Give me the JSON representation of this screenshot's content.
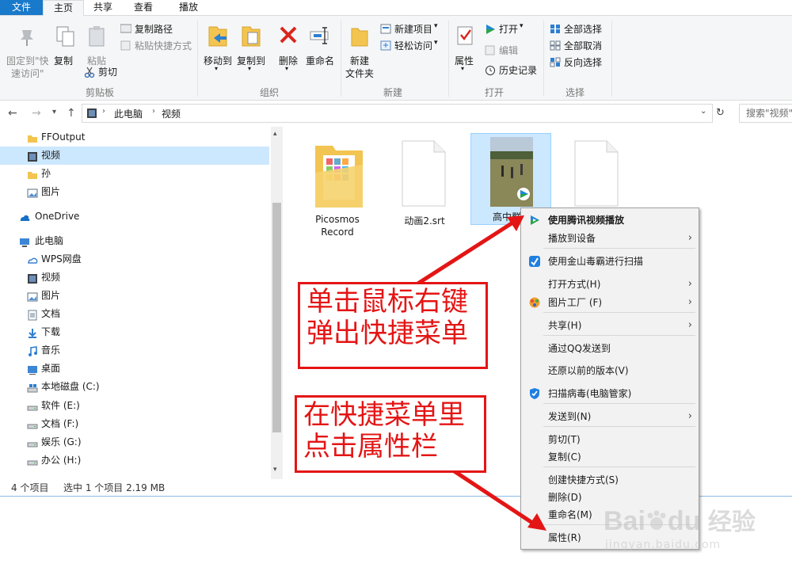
{
  "ribbon_tabs": [
    "文件",
    "主页",
    "共享",
    "查看",
    "播放"
  ],
  "ribbon": {
    "pin_label_1": "固定到\"快",
    "pin_label_2": "速访问\"",
    "copy": "复制",
    "paste": "粘贴",
    "copy_path": "复制路径",
    "paste_shortcut": "粘贴快捷方式",
    "cut": "剪切",
    "clipboard_group": "剪贴板",
    "move_to": "移动到",
    "copy_to": "复制到",
    "delete": "删除",
    "rename": "重命名",
    "organize_group": "组织",
    "new_folder_1": "新建",
    "new_folder_2": "文件夹",
    "new_item": "新建项目",
    "easy_access": "轻松访问",
    "new_group": "新建",
    "properties": "属性",
    "open": "打开",
    "edit": "编辑",
    "history": "历史记录",
    "open_group": "打开",
    "select_all": "全部选择",
    "select_none": "全部取消",
    "invert_selection": "反向选择",
    "select_group": "选择"
  },
  "address": {
    "crumbs": [
      "此电脑",
      "视频"
    ],
    "search_placeholder": "搜索\"视频\""
  },
  "sidebar": [
    {
      "label": "FFOutput",
      "icon": "folder-icon"
    },
    {
      "label": "视频",
      "icon": "video-folder-icon",
      "selected": true
    },
    {
      "label": "孙",
      "icon": "folder-icon"
    },
    {
      "label": "图片",
      "icon": "pictures-icon"
    },
    {
      "label": "OneDrive",
      "icon": "onedrive-icon"
    },
    {
      "label": "此电脑",
      "icon": "computer-icon"
    },
    {
      "label": "WPS网盘",
      "icon": "cloud-drive-icon"
    },
    {
      "label": "视频",
      "icon": "video-folder-icon"
    },
    {
      "label": "图片",
      "icon": "pictures-icon"
    },
    {
      "label": "文档",
      "icon": "documents-icon"
    },
    {
      "label": "下载",
      "icon": "download-icon"
    },
    {
      "label": "音乐",
      "icon": "music-icon"
    },
    {
      "label": "桌面",
      "icon": "desktop-icon"
    },
    {
      "label": "本地磁盘 (C:)",
      "icon": "system-drive-icon"
    },
    {
      "label": "软件 (E:)",
      "icon": "drive-icon"
    },
    {
      "label": "文档 (F:)",
      "icon": "drive-icon"
    },
    {
      "label": "娱乐 (G:)",
      "icon": "drive-icon"
    },
    {
      "label": "办公 (H:)",
      "icon": "drive-icon"
    }
  ],
  "files": [
    {
      "name_line1": "Picosmos",
      "name_line2": "Record",
      "icon": "folder-icon"
    },
    {
      "name_line1": "动画2.srt",
      "icon": "document-icon"
    },
    {
      "name_line1": "高中群",
      "icon": "video-file-icon",
      "selected": true
    },
    {
      "name_line1": "",
      "icon": "document-icon"
    }
  ],
  "status": {
    "count": "4 个项目",
    "selection": "选中 1 个项目  2.19 MB"
  },
  "context_menu": [
    {
      "label": "使用腾讯视频播放",
      "bold": true,
      "icon": "tencent-video-icon"
    },
    {
      "label": "播放到设备",
      "submenu": true
    },
    {
      "label": "使用金山毒霸进行扫描",
      "icon": "duba-icon"
    },
    {
      "label": "打开方式(H)",
      "submenu": true
    },
    {
      "label": "图片工厂 (F)",
      "submenu": true,
      "icon": "picture-factory-icon"
    },
    {
      "label": "共享(H)",
      "submenu": true
    },
    {
      "label": "通过QQ发送到"
    },
    {
      "label": "还原以前的版本(V)"
    },
    {
      "label": "扫描病毒(电脑管家)",
      "icon": "pc-manager-icon"
    },
    {
      "label": "发送到(N)",
      "submenu": true
    },
    {
      "label": "剪切(T)"
    },
    {
      "label": "复制(C)"
    },
    {
      "label": "创建快捷方式(S)"
    },
    {
      "label": "删除(D)"
    },
    {
      "label": "重命名(M)"
    },
    {
      "label": "属性(R)"
    }
  ],
  "annotations": {
    "box1_line1": "单击鼠标右键",
    "box1_line2": "弹出快捷菜单",
    "box2_line1": "在快捷菜单里",
    "box2_line2": "点击属性栏"
  },
  "watermark": {
    "brand": "Bai",
    "brand2": "du",
    "cn": "经验",
    "url": "jingyan.baidu.com"
  },
  "colors": {
    "accent": "#1979ca",
    "selection": "#cce8ff",
    "annotation_red": "#e41515"
  }
}
